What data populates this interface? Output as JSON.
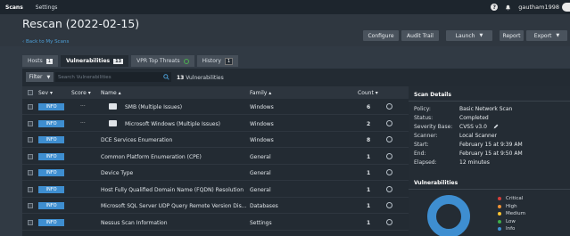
{
  "topbar": {
    "nav": [
      "Scans",
      "Settings"
    ],
    "help_icon_label": "?",
    "username": "gautham1998"
  },
  "header": {
    "title": "Rescan (2022-02-15)",
    "back_link": "‹ Back to My Scans",
    "buttons": {
      "configure": "Configure",
      "audit_trail": "Audit Trail",
      "launch": "Launch",
      "report": "Report",
      "export": "Export"
    }
  },
  "tabs": [
    {
      "label": "Hosts",
      "badge": "1"
    },
    {
      "label": "Vulnerabilities",
      "badge": "13"
    },
    {
      "label": "VPR Top Threats",
      "badge": ""
    },
    {
      "label": "History",
      "badge": "1"
    }
  ],
  "filter": {
    "label": "Filter",
    "search_placeholder": "Search Vulnerabilities",
    "count": "13",
    "count_suffix": "Vulnerabilities"
  },
  "table": {
    "columns": {
      "sev": "Sev",
      "score": "Score",
      "name": "Name",
      "family": "Family",
      "count": "Count"
    },
    "rows": [
      {
        "sev": "INFO",
        "score": "...",
        "folder": true,
        "name": "SMB (Multiple Issues)",
        "family": "Windows",
        "count": "6"
      },
      {
        "sev": "INFO",
        "score": "...",
        "folder": true,
        "name": "Microsoft Windows (Multiple Issues)",
        "family": "Windows",
        "count": "2"
      },
      {
        "sev": "INFO",
        "score": "",
        "folder": false,
        "name": "DCE Services Enumeration",
        "family": "Windows",
        "count": "8"
      },
      {
        "sev": "INFO",
        "score": "",
        "folder": false,
        "name": "Common Platform Enumeration (CPE)",
        "family": "General",
        "count": "1"
      },
      {
        "sev": "INFO",
        "score": "",
        "folder": false,
        "name": "Device Type",
        "family": "General",
        "count": "1"
      },
      {
        "sev": "INFO",
        "score": "",
        "folder": false,
        "name": "Host Fully Qualified Domain Name (FQDN) Resolution",
        "family": "General",
        "count": "1"
      },
      {
        "sev": "INFO",
        "score": "",
        "folder": false,
        "name": "Microsoft SQL Server UDP Query Remote Version Dis...",
        "family": "Databases",
        "count": "1"
      },
      {
        "sev": "INFO",
        "score": "",
        "folder": false,
        "name": "Nessus Scan Information",
        "family": "Settings",
        "count": "1"
      }
    ]
  },
  "scan_details": {
    "title": "Scan Details",
    "items": [
      {
        "label": "Policy:",
        "value": "Basic Network Scan"
      },
      {
        "label": "Status:",
        "value": "Completed"
      },
      {
        "label": "Severity Base:",
        "value": "CVSS v3.0"
      },
      {
        "label": "Scanner:",
        "value": "Local Scanner"
      },
      {
        "label": "Start:",
        "value": "February 15 at 9:39 AM"
      },
      {
        "label": "End:",
        "value": "February 15 at 9:50 AM"
      },
      {
        "label": "Elapsed:",
        "value": "12 minutes"
      }
    ]
  },
  "vulnerabilities_chart": {
    "title": "Vulnerabilities",
    "legend": [
      {
        "label": "Critical",
        "color": "#d43f3a"
      },
      {
        "label": "High",
        "color": "#ee9336"
      },
      {
        "label": "Medium",
        "color": "#fdc431"
      },
      {
        "label": "Low",
        "color": "#3fae49"
      },
      {
        "label": "Info",
        "color": "#3e8ed0"
      }
    ],
    "donut_color": "#3e8ed0"
  },
  "colors": {
    "info": "#3e8ed0",
    "topbar": "#1d252d",
    "panel": "#232b33"
  }
}
